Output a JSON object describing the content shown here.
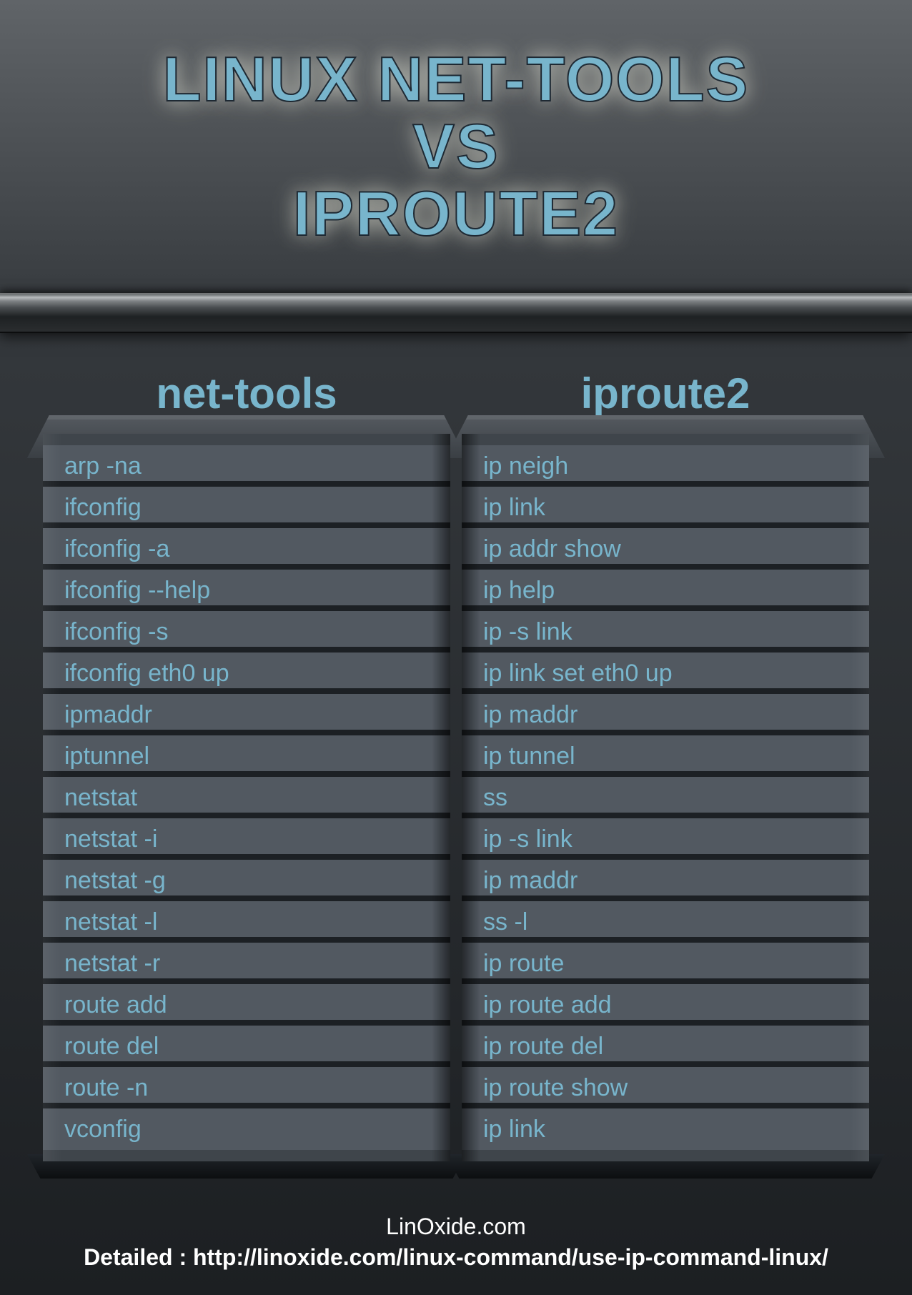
{
  "title": {
    "line1": "LINUX NET-TOOLS",
    "line2": "VS",
    "line3": "IPROUTE2"
  },
  "columns": {
    "left": {
      "heading": "net-tools"
    },
    "right": {
      "heading": "iproute2"
    }
  },
  "rows": {
    "left": [
      "arp -na",
      "ifconfig",
      "ifconfig -a",
      "ifconfig --help",
      "ifconfig -s",
      "ifconfig eth0 up",
      "ipmaddr",
      "iptunnel",
      "netstat",
      "netstat -i",
      "netstat  -g",
      "netstat -l",
      "netstat -r",
      "route add",
      "route del",
      "route -n",
      "vconfig"
    ],
    "right": [
      "ip neigh",
      "ip link",
      "ip addr show",
      "ip help",
      "ip -s link",
      "ip link set eth0 up",
      "ip maddr",
      "ip tunnel",
      "ss",
      "ip -s link",
      "ip maddr",
      "ss -l",
      "ip route",
      "ip route add",
      "ip route del",
      "ip route show",
      "ip link"
    ]
  },
  "footer": {
    "site": "LinOxide.com",
    "detail_label": "Detailed : ",
    "detail_url": "http://linoxide.com/linux-command/use-ip-command-linux/"
  }
}
